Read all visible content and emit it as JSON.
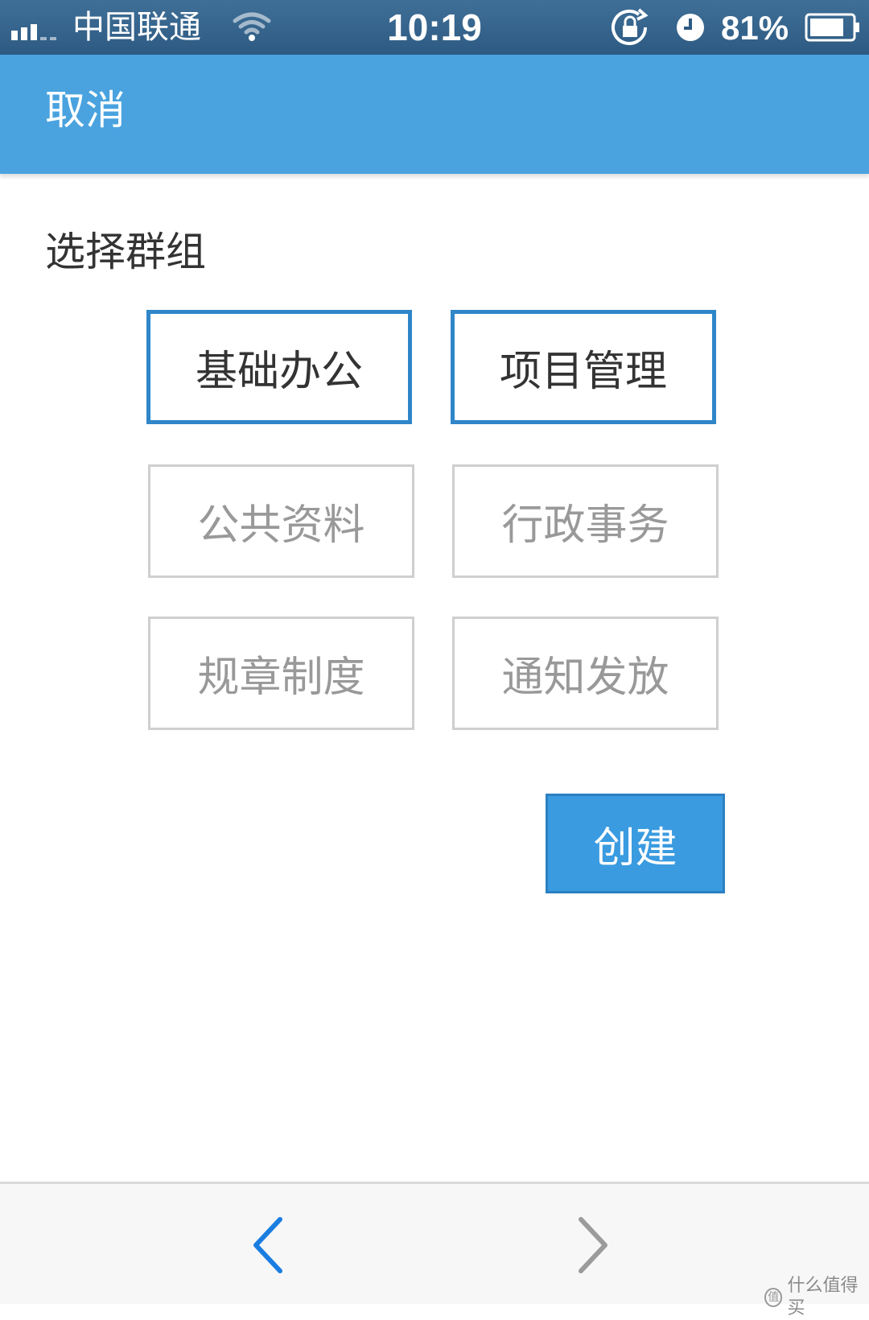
{
  "status_bar": {
    "carrier": "中国联通",
    "time": "10:19",
    "battery_percent": "81%",
    "icons": [
      "signal-icon",
      "wifi-icon",
      "rotation-lock-icon",
      "alarm-icon",
      "battery-icon"
    ]
  },
  "nav": {
    "cancel_label": "取消"
  },
  "section": {
    "title": "选择群组"
  },
  "groups": [
    {
      "label": "基础办公",
      "selected": true
    },
    {
      "label": "项目管理",
      "selected": true
    },
    {
      "label": "公共资料",
      "selected": false
    },
    {
      "label": "行政事务",
      "selected": false
    },
    {
      "label": "规章制度",
      "selected": false
    },
    {
      "label": "通知发放",
      "selected": false
    }
  ],
  "create_label": "创建",
  "toolbar": {
    "icons": [
      "back-arrow-icon",
      "forward-arrow-icon"
    ]
  },
  "watermark": {
    "text": "什么值得买",
    "badge": "值"
  },
  "colors": {
    "nav_bar": "#4aa3df",
    "status_bar": "#2d5a82",
    "selected_border": "#2f86c8",
    "create_button": "#3a9be0"
  }
}
